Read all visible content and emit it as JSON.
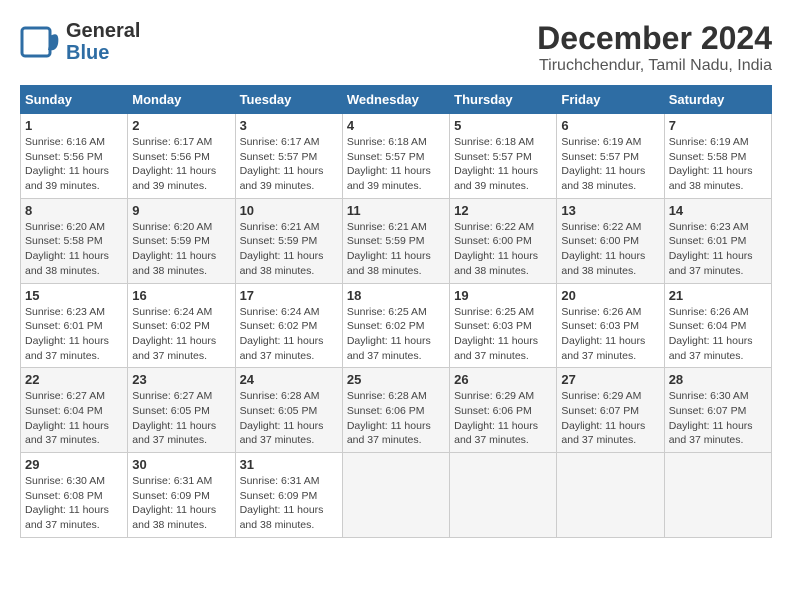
{
  "header": {
    "logo_line1": "General",
    "logo_line2": "Blue",
    "main_title": "December 2024",
    "subtitle": "Tiruchchendur, Tamil Nadu, India"
  },
  "weekdays": [
    "Sunday",
    "Monday",
    "Tuesday",
    "Wednesday",
    "Thursday",
    "Friday",
    "Saturday"
  ],
  "weeks": [
    [
      {
        "day": "1",
        "sunrise": "6:16 AM",
        "sunset": "5:56 PM",
        "daylight": "11 hours and 39 minutes."
      },
      {
        "day": "2",
        "sunrise": "6:17 AM",
        "sunset": "5:56 PM",
        "daylight": "11 hours and 39 minutes."
      },
      {
        "day": "3",
        "sunrise": "6:17 AM",
        "sunset": "5:57 PM",
        "daylight": "11 hours and 39 minutes."
      },
      {
        "day": "4",
        "sunrise": "6:18 AM",
        "sunset": "5:57 PM",
        "daylight": "11 hours and 39 minutes."
      },
      {
        "day": "5",
        "sunrise": "6:18 AM",
        "sunset": "5:57 PM",
        "daylight": "11 hours and 39 minutes."
      },
      {
        "day": "6",
        "sunrise": "6:19 AM",
        "sunset": "5:57 PM",
        "daylight": "11 hours and 38 minutes."
      },
      {
        "day": "7",
        "sunrise": "6:19 AM",
        "sunset": "5:58 PM",
        "daylight": "11 hours and 38 minutes."
      }
    ],
    [
      {
        "day": "8",
        "sunrise": "6:20 AM",
        "sunset": "5:58 PM",
        "daylight": "11 hours and 38 minutes."
      },
      {
        "day": "9",
        "sunrise": "6:20 AM",
        "sunset": "5:59 PM",
        "daylight": "11 hours and 38 minutes."
      },
      {
        "day": "10",
        "sunrise": "6:21 AM",
        "sunset": "5:59 PM",
        "daylight": "11 hours and 38 minutes."
      },
      {
        "day": "11",
        "sunrise": "6:21 AM",
        "sunset": "5:59 PM",
        "daylight": "11 hours and 38 minutes."
      },
      {
        "day": "12",
        "sunrise": "6:22 AM",
        "sunset": "6:00 PM",
        "daylight": "11 hours and 38 minutes."
      },
      {
        "day": "13",
        "sunrise": "6:22 AM",
        "sunset": "6:00 PM",
        "daylight": "11 hours and 38 minutes."
      },
      {
        "day": "14",
        "sunrise": "6:23 AM",
        "sunset": "6:01 PM",
        "daylight": "11 hours and 37 minutes."
      }
    ],
    [
      {
        "day": "15",
        "sunrise": "6:23 AM",
        "sunset": "6:01 PM",
        "daylight": "11 hours and 37 minutes."
      },
      {
        "day": "16",
        "sunrise": "6:24 AM",
        "sunset": "6:02 PM",
        "daylight": "11 hours and 37 minutes."
      },
      {
        "day": "17",
        "sunrise": "6:24 AM",
        "sunset": "6:02 PM",
        "daylight": "11 hours and 37 minutes."
      },
      {
        "day": "18",
        "sunrise": "6:25 AM",
        "sunset": "6:02 PM",
        "daylight": "11 hours and 37 minutes."
      },
      {
        "day": "19",
        "sunrise": "6:25 AM",
        "sunset": "6:03 PM",
        "daylight": "11 hours and 37 minutes."
      },
      {
        "day": "20",
        "sunrise": "6:26 AM",
        "sunset": "6:03 PM",
        "daylight": "11 hours and 37 minutes."
      },
      {
        "day": "21",
        "sunrise": "6:26 AM",
        "sunset": "6:04 PM",
        "daylight": "11 hours and 37 minutes."
      }
    ],
    [
      {
        "day": "22",
        "sunrise": "6:27 AM",
        "sunset": "6:04 PM",
        "daylight": "11 hours and 37 minutes."
      },
      {
        "day": "23",
        "sunrise": "6:27 AM",
        "sunset": "6:05 PM",
        "daylight": "11 hours and 37 minutes."
      },
      {
        "day": "24",
        "sunrise": "6:28 AM",
        "sunset": "6:05 PM",
        "daylight": "11 hours and 37 minutes."
      },
      {
        "day": "25",
        "sunrise": "6:28 AM",
        "sunset": "6:06 PM",
        "daylight": "11 hours and 37 minutes."
      },
      {
        "day": "26",
        "sunrise": "6:29 AM",
        "sunset": "6:06 PM",
        "daylight": "11 hours and 37 minutes."
      },
      {
        "day": "27",
        "sunrise": "6:29 AM",
        "sunset": "6:07 PM",
        "daylight": "11 hours and 37 minutes."
      },
      {
        "day": "28",
        "sunrise": "6:30 AM",
        "sunset": "6:07 PM",
        "daylight": "11 hours and 37 minutes."
      }
    ],
    [
      {
        "day": "29",
        "sunrise": "6:30 AM",
        "sunset": "6:08 PM",
        "daylight": "11 hours and 37 minutes."
      },
      {
        "day": "30",
        "sunrise": "6:31 AM",
        "sunset": "6:09 PM",
        "daylight": "11 hours and 38 minutes."
      },
      {
        "day": "31",
        "sunrise": "6:31 AM",
        "sunset": "6:09 PM",
        "daylight": "11 hours and 38 minutes."
      },
      null,
      null,
      null,
      null
    ]
  ]
}
